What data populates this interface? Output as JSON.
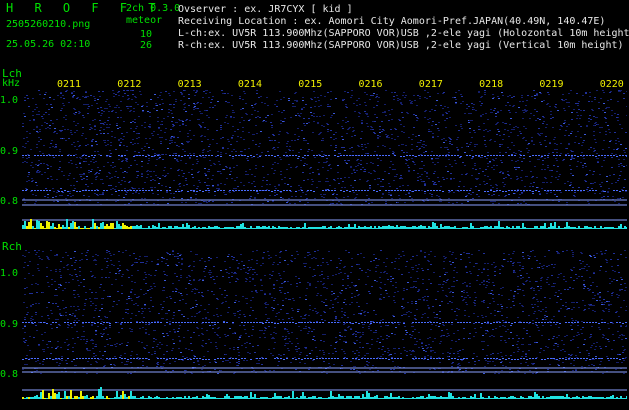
{
  "header": {
    "app_title": "H R O F F T",
    "filename": "2505260210.png",
    "datetime": "25.05.26 02:10",
    "mode": "2ch 0.3.0",
    "meteor_label": "meteor",
    "l_count": "10",
    "r_count": "26"
  },
  "info": {
    "observer": "Ovserver              : ex. JR7CYX [ kid ]",
    "location": "Receiving Location : ex. Aomori City Aomori-Pref.JAPAN(40.49N, 140.47E)",
    "lch": "L-ch:ex. UV5R 113.900Mhz(SAPPORO VOR)USB ,2-ele yagi (Holozontal 10m height)",
    "rch": "R-ch:ex. UV5R 113.900Mhz(SAPPORO VOR)USB ,2-ele yagi (Vertical 10m height)"
  },
  "axes": {
    "l_label": "Lch",
    "r_label": "Rch",
    "unit": "kHz",
    "time_ticks": [
      "0211",
      "0212",
      "0213",
      "0214",
      "0215",
      "0216",
      "0217",
      "0218",
      "0219",
      "0220"
    ],
    "freq_ticks": [
      "1.0",
      "0.9",
      "0.8"
    ]
  },
  "colors": {
    "background": "#000000",
    "header_text": "#00e000",
    "info_text": "#e8e8e8",
    "time_text": "#f0f000",
    "spectrum_noise": "#1a2a9a",
    "carrier_line": "#4a6cff",
    "marker_line": "#8aa0ff",
    "activity_cyan": "#20e0e0",
    "activity_yellow": "#f0f000"
  }
}
